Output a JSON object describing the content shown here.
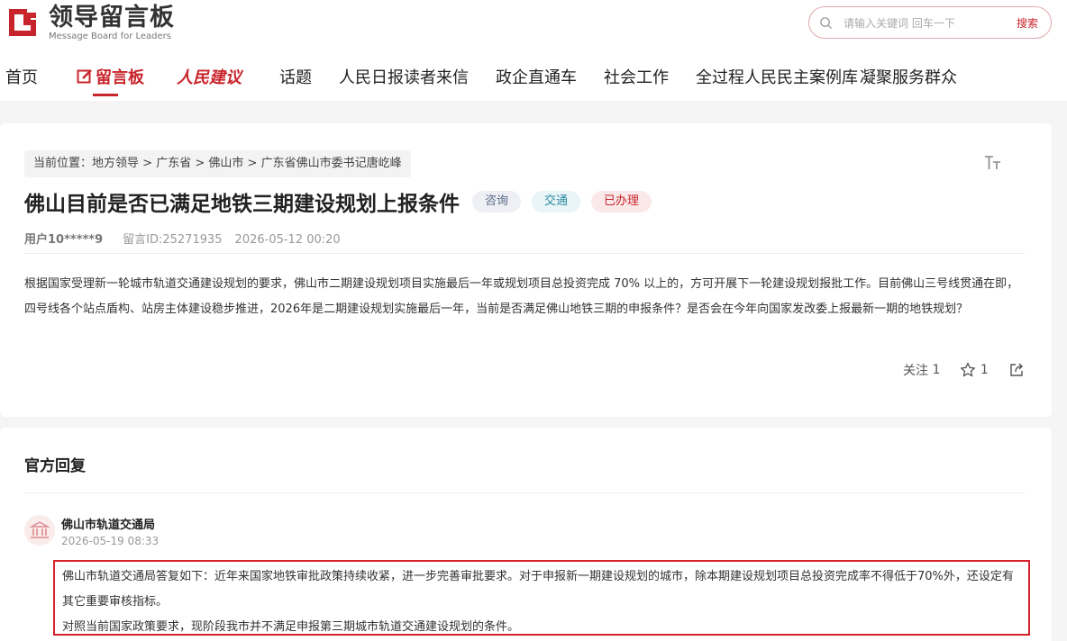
{
  "header": {
    "logo_cn": "领导留言板",
    "logo_en": "Message Board for Leaders",
    "search": {
      "placeholder": "请输入关键词 回车一下",
      "button": "搜索"
    }
  },
  "nav": {
    "items": [
      {
        "label": "首页"
      },
      {
        "label": "留言板",
        "active": true
      },
      {
        "label": "人民建议"
      },
      {
        "label": "话题"
      },
      {
        "label": "人民日报读者来信"
      },
      {
        "label": "政企直通车"
      },
      {
        "label": "社会工作"
      },
      {
        "label": "全过程人民民主案例库"
      },
      {
        "label": "凝聚服务群众"
      }
    ]
  },
  "message": {
    "breadcrumb": {
      "prefix": "当前位置：",
      "items": [
        "地方领导",
        "广东省",
        "佛山市",
        "广东省佛山市委书记唐屹峰"
      ],
      "separator": " > "
    },
    "title": "佛山目前是否已满足地铁三期建设规划上报条件",
    "tags": [
      "咨询",
      "交通",
      "已办理"
    ],
    "user": "用户10*****9",
    "id_label": "留言ID:25271935",
    "time": "2026-05-12 00:20",
    "content": "根据国家受理新一轮城市轨道交通建设规划的要求，佛山市二期建设规划项目实施最后一年或规划项目总投资完成 70% 以上的，方可开展下一轮建设规划报批工作。目前佛山三号线贯通在即，四号线各个站点盾构、站房主体建设稳步推进，2026年是二期建设规划实施最后一年，当前是否满足佛山地铁三期的申报条件？是否会在今年向国家发改委上报最新一期的地铁规划？",
    "actions": {
      "follow_label": "关注",
      "follow_count": "1",
      "star_count": "1"
    }
  },
  "reply": {
    "header": "官方回复",
    "department": "佛山市轨道交通局",
    "time": "2026-05-19 08:33",
    "paragraphs": [
      "佛山市轨道交通局答复如下：近年来国家地铁审批政策持续收紧，进一步完善审批要求。对于申报新一期建设规划的城市，除本期建设规划项目总投资完成率不得低于70%外，还设定有其它重要审核指标。",
      "对照当前国家政策要求，现阶段我市并不满足申报第三期城市轨道交通建设规划的条件。"
    ]
  },
  "colors": {
    "brand_red": "#c8242b",
    "highlight_border": "#d4222a"
  },
  "icons": [
    "logo-icon",
    "search-icon",
    "edit-icon",
    "font-size-icon",
    "star-icon",
    "share-icon",
    "government-building-icon"
  ]
}
